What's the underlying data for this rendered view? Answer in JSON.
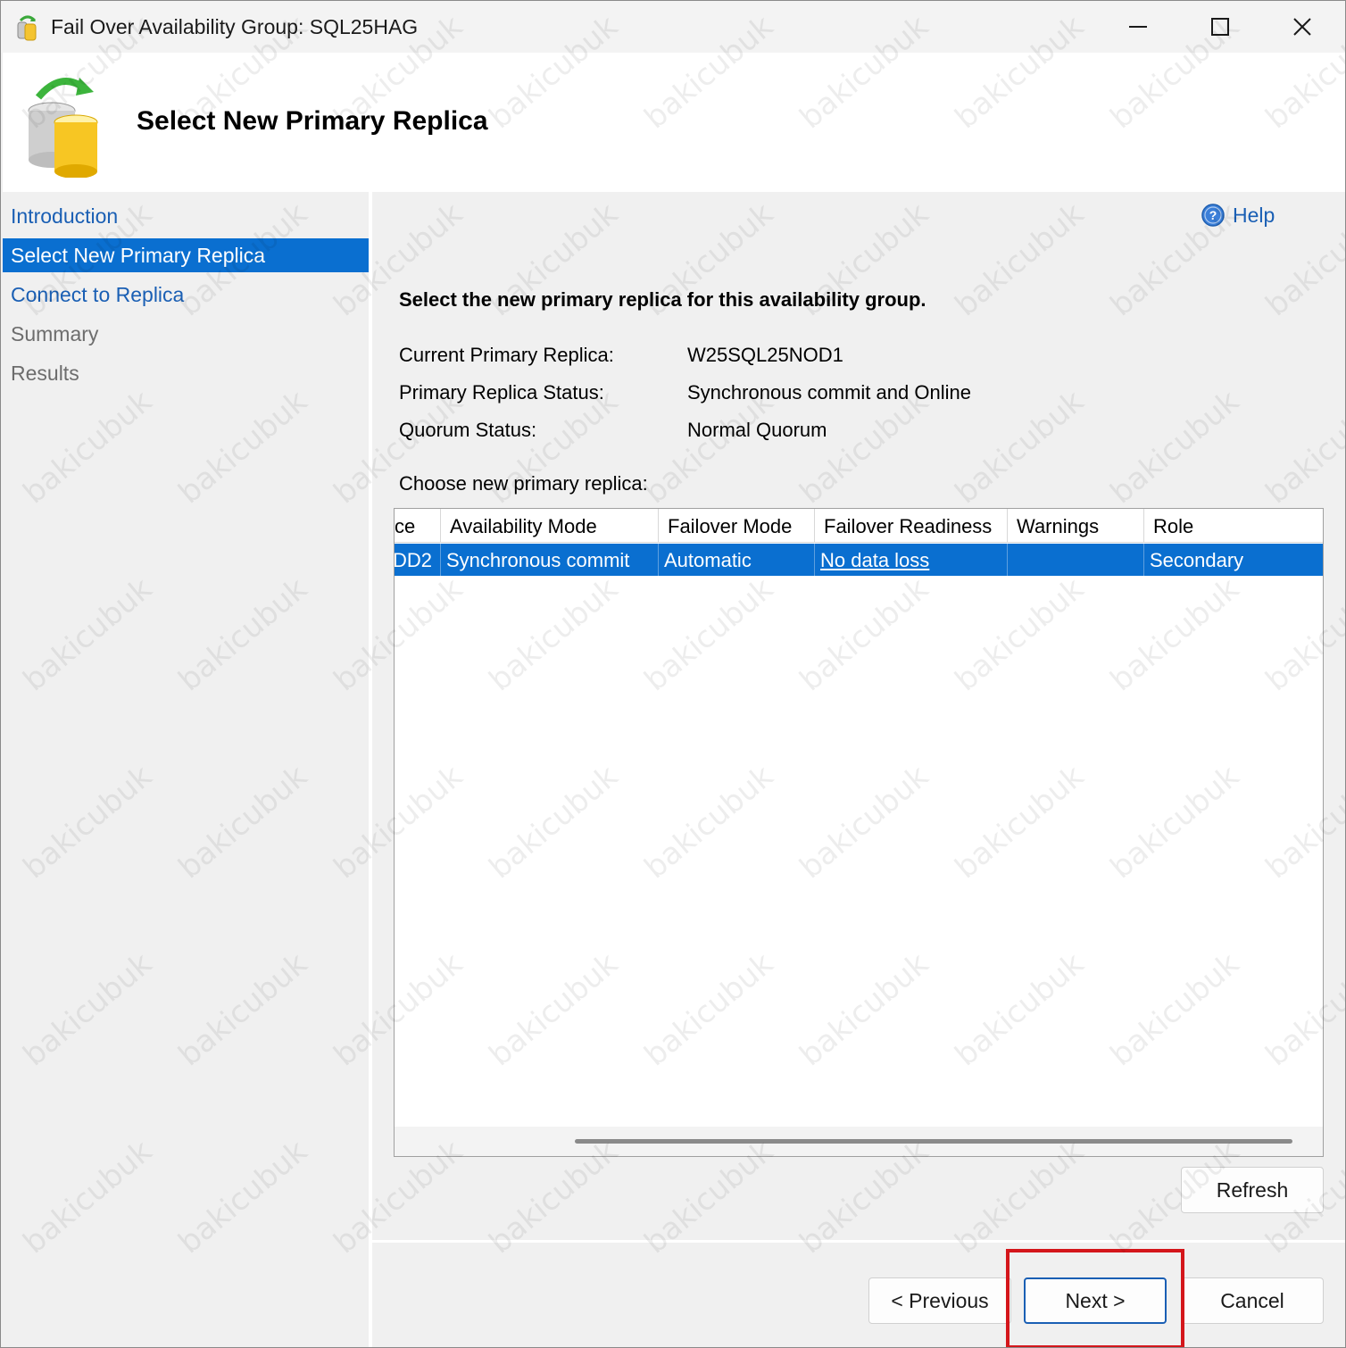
{
  "window": {
    "title": "Fail Over Availability Group: SQL25HAG",
    "icon": "database-failover-icon"
  },
  "header": {
    "title": "Select New Primary Replica",
    "icon": "database-failover-large-icon"
  },
  "sidebar": {
    "items": [
      {
        "label": "Introduction",
        "state": "link"
      },
      {
        "label": "Select New Primary Replica",
        "state": "active"
      },
      {
        "label": "Connect to Replica",
        "state": "link"
      },
      {
        "label": "Summary",
        "state": "disabled"
      },
      {
        "label": "Results",
        "state": "disabled"
      }
    ]
  },
  "main": {
    "help_label": "Help",
    "instruction": "Select the new primary replica for this availability group.",
    "info": [
      {
        "label": "Current Primary Replica:",
        "value": "W25SQL25NOD1"
      },
      {
        "label": "Primary Replica Status:",
        "value": "Synchronous commit and Online"
      },
      {
        "label": "Quorum Status:",
        "value": "Normal Quorum"
      }
    ],
    "choose_label": "Choose new primary replica:",
    "grid": {
      "columns": [
        "ce",
        "Availability Mode",
        "Failover Mode",
        "Failover Readiness",
        "Warnings",
        "Role"
      ],
      "rows": [
        {
          "cells": [
            "DD2",
            "Synchronous commit",
            "Automatic",
            "No data loss",
            "",
            "Secondary"
          ],
          "selected": true
        }
      ]
    },
    "refresh_label": "Refresh"
  },
  "footer": {
    "previous_label": "< Previous",
    "next_label": "Next >",
    "cancel_label": "Cancel"
  },
  "colors": {
    "selection": "#0a6fd0",
    "link": "#1a5fb4",
    "highlight_box": "#d4161b"
  },
  "watermark": "bakicubuk"
}
